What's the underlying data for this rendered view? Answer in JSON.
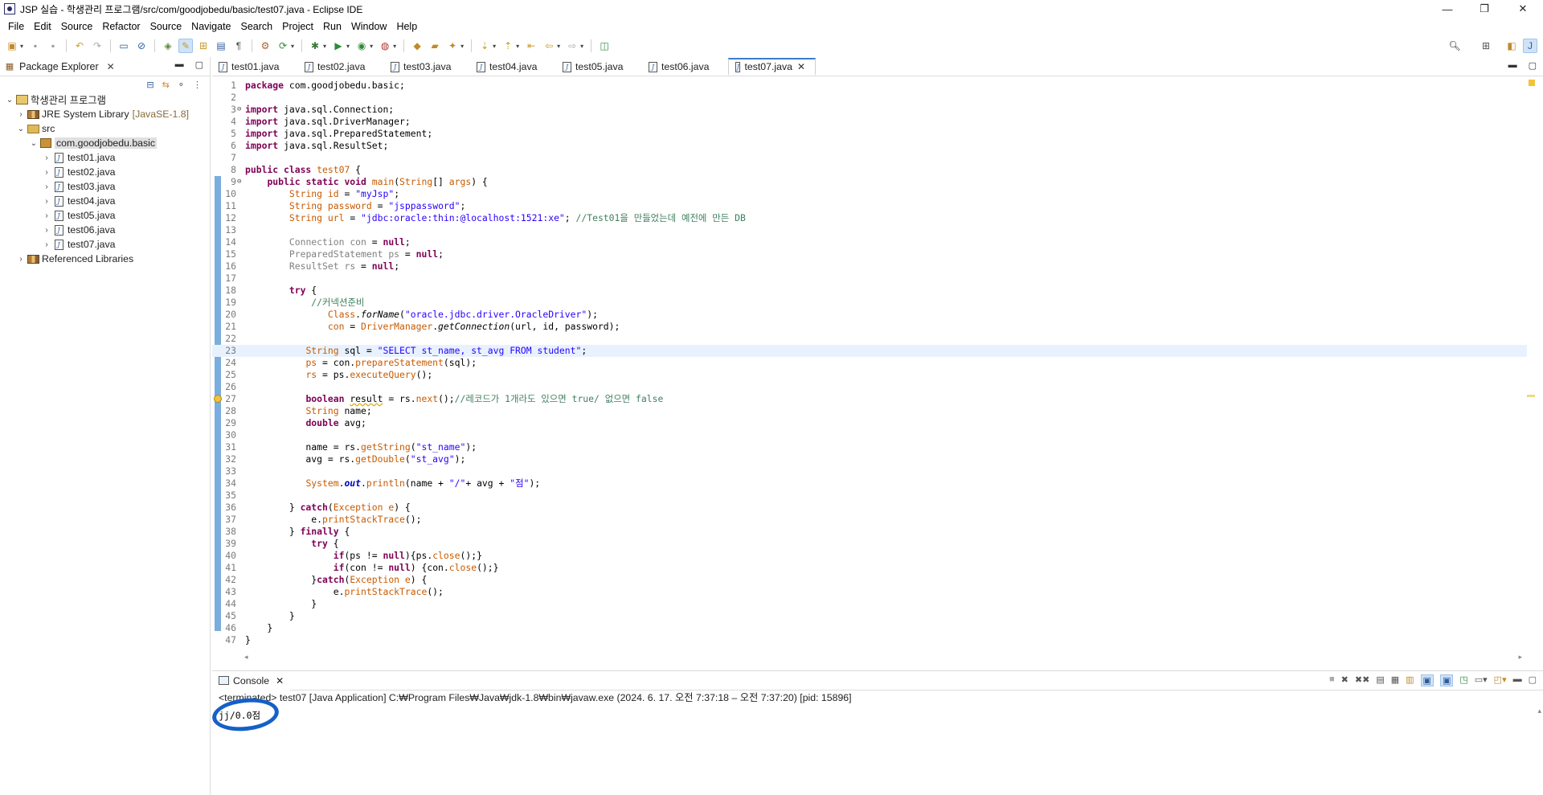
{
  "window": {
    "title": "JSP 실습 - 학생관리 프로그램/src/com/goodjobedu/basic/test07.java - Eclipse IDE",
    "controls": [
      "—",
      "❐",
      "✕"
    ]
  },
  "menu": [
    "File",
    "Edit",
    "Source",
    "Refactor",
    "Source",
    "Navigate",
    "Search",
    "Project",
    "Run",
    "Window",
    "Help"
  ],
  "package_explorer": {
    "title": "Package Explorer",
    "tree": {
      "project": "학생관리 프로그램",
      "jre": "JRE System Library",
      "jre_version": "[JavaSE-1.8]",
      "src": "src",
      "package": "com.goodjobedu.basic",
      "files": [
        "test01.java",
        "test02.java",
        "test03.java",
        "test04.java",
        "test05.java",
        "test06.java",
        "test07.java"
      ],
      "ref_libs": "Referenced Libraries"
    }
  },
  "editor": {
    "tabs": [
      "test01.java",
      "test02.java",
      "test03.java",
      "test04.java",
      "test05.java",
      "test06.java",
      "test07.java"
    ],
    "active_tab": "test07.java",
    "line_numbers": [
      "1",
      "2",
      "3",
      "4",
      "5",
      "6",
      "7",
      "8",
      "9",
      "10",
      "11",
      "12",
      "13",
      "14",
      "15",
      "16",
      "17",
      "18",
      "19",
      "20",
      "21",
      "22",
      "23",
      "24",
      "25",
      "26",
      "27",
      "28",
      "29",
      "30",
      "31",
      "32",
      "33",
      "34",
      "35",
      "36",
      "37",
      "38",
      "39",
      "40",
      "41",
      "42",
      "43",
      "44",
      "45",
      "46",
      "47"
    ]
  },
  "console": {
    "title": "Console",
    "status": "<terminated> test07 [Java Application] C:₩Program Files₩Java₩jdk-1.8₩bin₩javaw.exe  (2024. 6. 17. 오전 7:37:18 – 오전 7:37:20) [pid: 15896]",
    "output": "jj/0.0점"
  },
  "colors": {
    "keyword": "#7f0055",
    "string": "#2a00ff",
    "comment": "#3f7f5f",
    "field": "#0000c0",
    "current_line": "#e8f2fe",
    "annotation_circle": "#1560c8"
  },
  "icons": [
    "java-file-icon",
    "package-icon",
    "folder-icon",
    "library-icon",
    "project-icon",
    "search-icon",
    "close-icon",
    "minimize-icon",
    "maximize-icon"
  ]
}
